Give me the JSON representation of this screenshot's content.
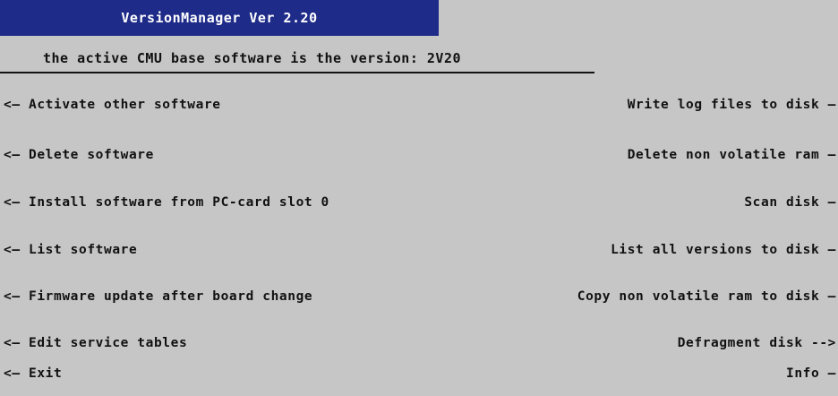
{
  "window": {
    "title": "VersionManager Ver 2.20"
  },
  "status": {
    "text": "the active CMU base software is the version: 2V20"
  },
  "left_menu": [
    {
      "arrow": "<—",
      "label": "Activate other software"
    },
    {
      "arrow": "<—",
      "label": "Delete software"
    },
    {
      "arrow": "<—",
      "label": "Install software from PC-card slot 0"
    },
    {
      "arrow": "<—",
      "label": "List software"
    },
    {
      "arrow": "<—",
      "label": "Firmware update after board change"
    },
    {
      "arrow": "<—",
      "label": "Edit service tables"
    },
    {
      "arrow": "<—",
      "label": "Exit"
    }
  ],
  "right_menu": [
    {
      "label": "Write log files to disk",
      "arrow": "—"
    },
    {
      "label": "Delete non volatile ram",
      "arrow": "—"
    },
    {
      "label": "Scan disk",
      "arrow": "—"
    },
    {
      "label": "List all versions to disk",
      "arrow": "—"
    },
    {
      "label": "Copy non volatile ram to disk",
      "arrow": "—"
    },
    {
      "label": "Defragment disk",
      "arrow": "-->"
    },
    {
      "label": "Info",
      "arrow": "—"
    }
  ],
  "colors": {
    "background": "#c6c6c6",
    "title_bar": "#1e2b88",
    "title_text": "#ffffff",
    "text": "#111111"
  }
}
